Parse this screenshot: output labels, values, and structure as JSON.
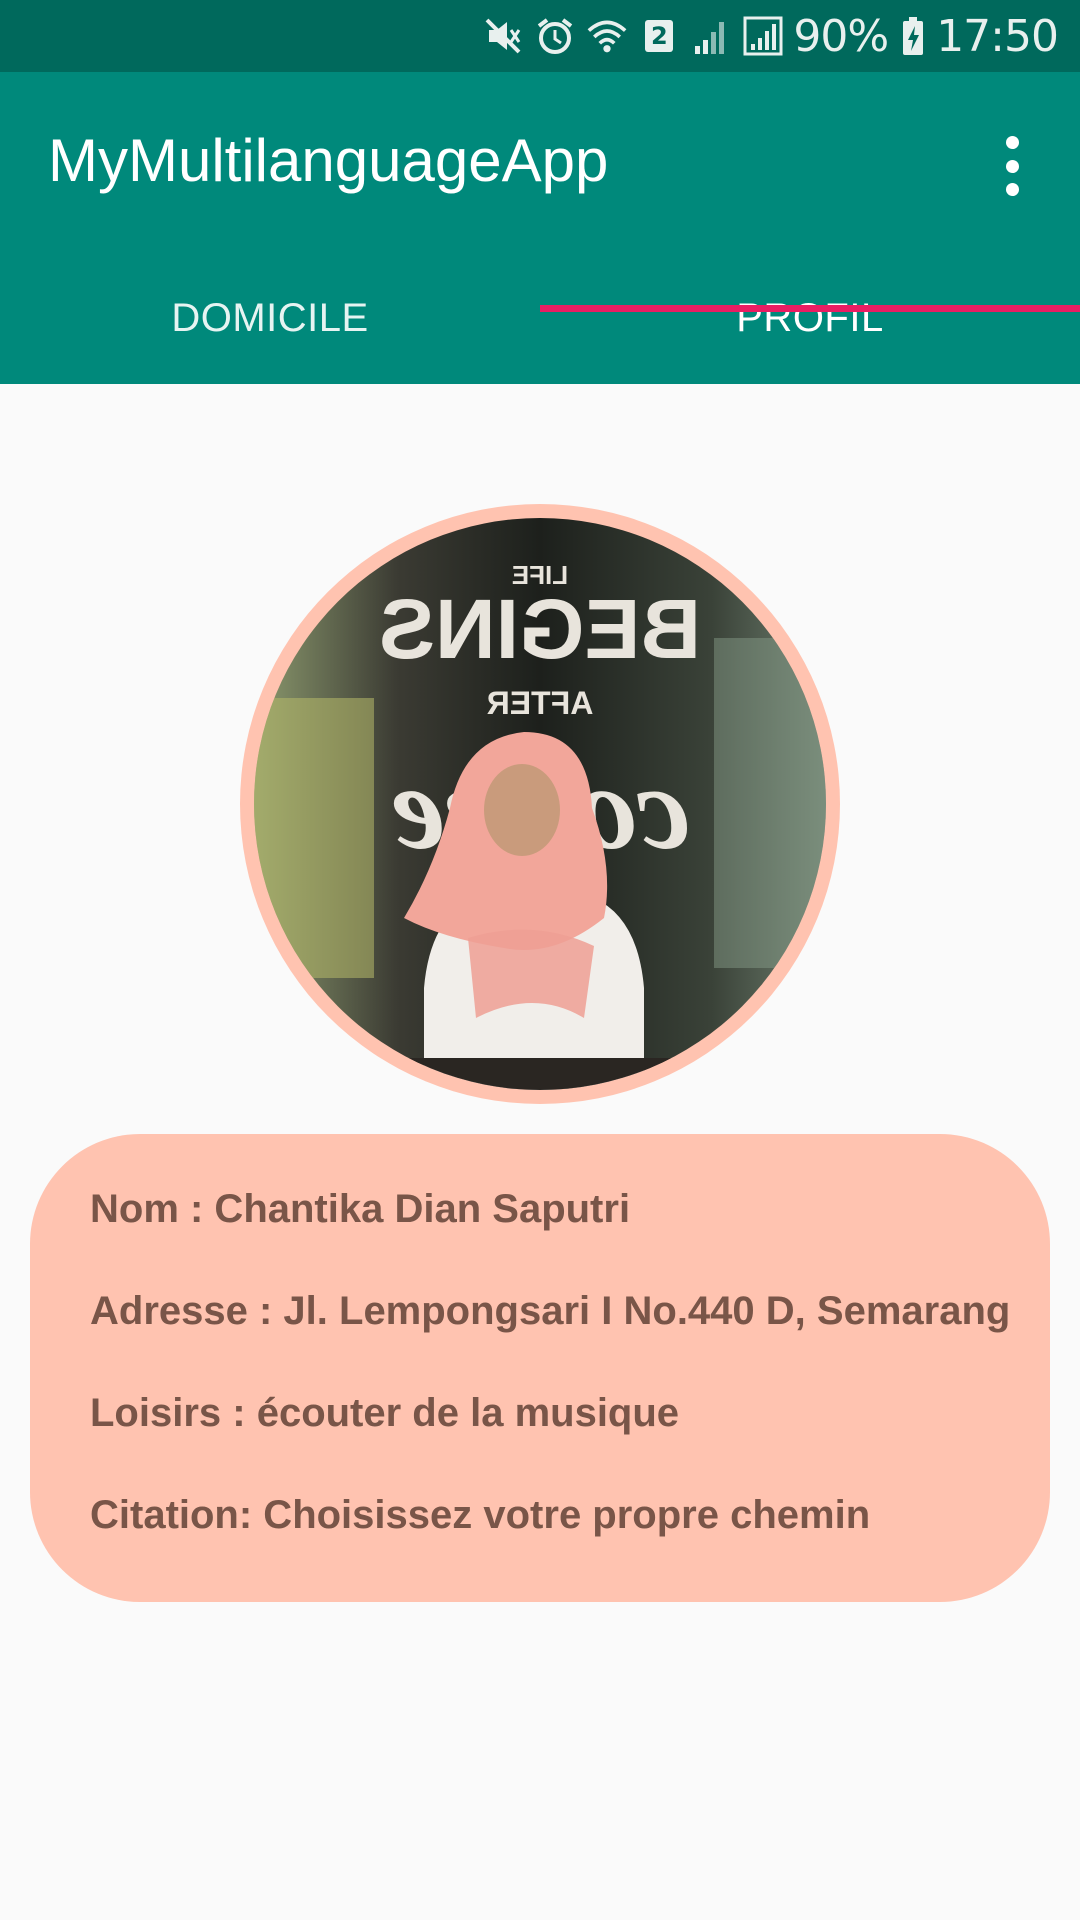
{
  "status_bar": {
    "battery": "90%",
    "time": "17:50",
    "sim_slot": "2",
    "icons": [
      "mute-icon",
      "alarm-icon",
      "wifi-icon",
      "sim-icon",
      "signal-icon",
      "signal-icon",
      "battery-charging-icon"
    ]
  },
  "app_bar": {
    "title": "MyMultilanguageApp",
    "overflow_icon": "more-vert-icon"
  },
  "tabs": [
    {
      "label": "DOMICILE",
      "selected": false
    },
    {
      "label": "PROFIL",
      "selected": true
    }
  ],
  "colors": {
    "status_bar": "#00695c",
    "primary": "#00897b",
    "accent": "#e91e63",
    "card": "#ffc3b0",
    "card_text": "#795548"
  },
  "profile": {
    "photo_sign": {
      "top": "LIFE",
      "main": "BEGINS",
      "middle": "AFTER",
      "script": "coffee"
    },
    "name_line": "Nom : Chantika Dian Saputri",
    "address_line": "Adresse : Jl. Lempongsari I No.440 D, Semarang",
    "hobby_line": "Loisirs : écouter de la musique",
    "quote_line": "Citation: Choisissez votre propre chemin"
  }
}
